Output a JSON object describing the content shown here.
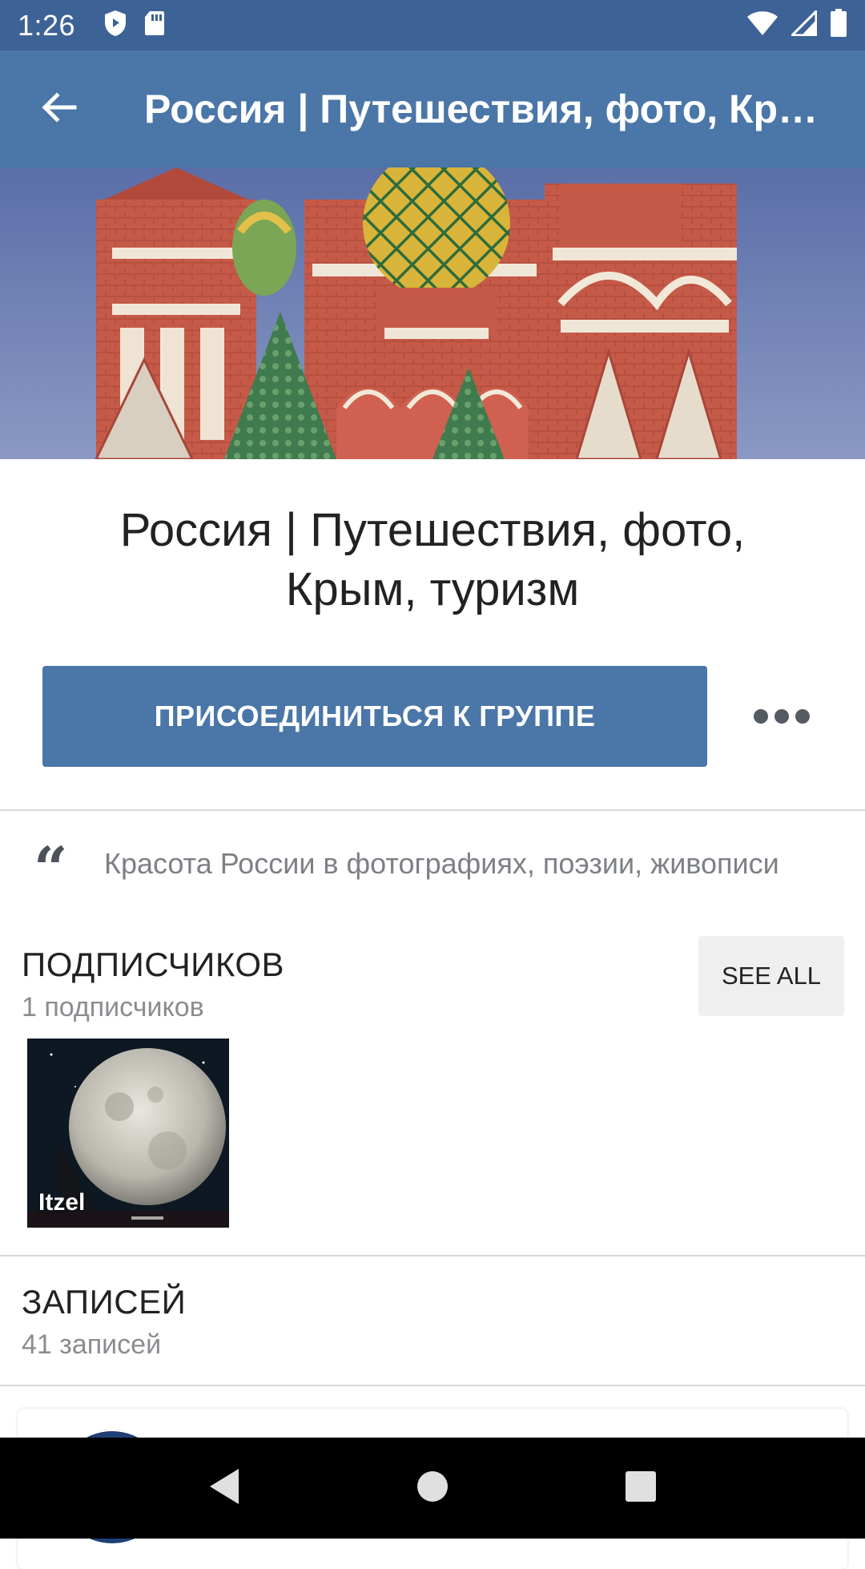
{
  "status_bar": {
    "time": "1:26",
    "icons": [
      "shield-play-icon",
      "sd-card-icon",
      "wifi-icon",
      "signal-icon",
      "battery-icon"
    ]
  },
  "app_bar": {
    "title": "Россия | Путешествия, фото, Крым, туризм",
    "back_icon": "arrow-back-icon"
  },
  "group": {
    "name": "Россия | Путешествия, фото, Крым, туризм",
    "join_label": "ПРИСОЕДИНИТЬСЯ К ГРУППЕ",
    "more_icon": "more-horizontal-icon",
    "quote": "Красота России в фотографиях, поэзии, живописи",
    "quote_icon": "quote-icon"
  },
  "subscribers": {
    "title": "ПОДПИСЧИКОВ",
    "count_text": "1 подписчиков",
    "see_all_label": "SEE ALL",
    "members": [
      {
        "name": "Itzel"
      }
    ]
  },
  "posts": {
    "title": "ЗАПИСЕЙ",
    "count_text": "41 записей"
  },
  "nav_bar": {
    "icons": [
      "back-triangle-icon",
      "home-circle-icon",
      "recents-square-icon"
    ]
  },
  "colors": {
    "status_bar": "#3d6296",
    "app_bar": "#4a76a8",
    "join_button": "#4a76a8"
  }
}
